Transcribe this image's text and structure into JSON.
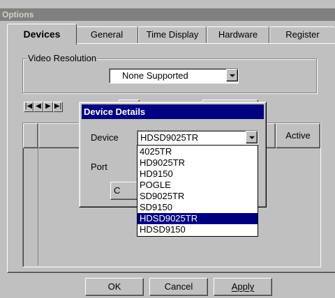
{
  "window": {
    "title": "Options"
  },
  "tabs": [
    {
      "label": "Devices",
      "active": true
    },
    {
      "label": "General"
    },
    {
      "label": "Time Display"
    },
    {
      "label": "Hardware"
    },
    {
      "label": "Register"
    }
  ],
  "video_resolution": {
    "label": "Video Resolution",
    "selected": "None Supported"
  },
  "device_table": {
    "column_active": "Active"
  },
  "dialog": {
    "title": "Device Details",
    "device_label": "Device",
    "device_value": "HDSD9025TR",
    "port_label": "Port",
    "button_partial": "C",
    "options": [
      "4025TR",
      "HD9025TR",
      "HD9150",
      "POGLE",
      "SD9025TR",
      "SD9150",
      "HDSD9025TR",
      "HDSD9150"
    ],
    "selected_option": "HDSD9025TR"
  },
  "footer": {
    "ok": "OK",
    "cancel": "Cancel",
    "apply": "Apply"
  },
  "colors": {
    "face": "#c0c0c0",
    "active_title": "#000080",
    "inactive_title": "#808080",
    "selection": "#000080"
  }
}
